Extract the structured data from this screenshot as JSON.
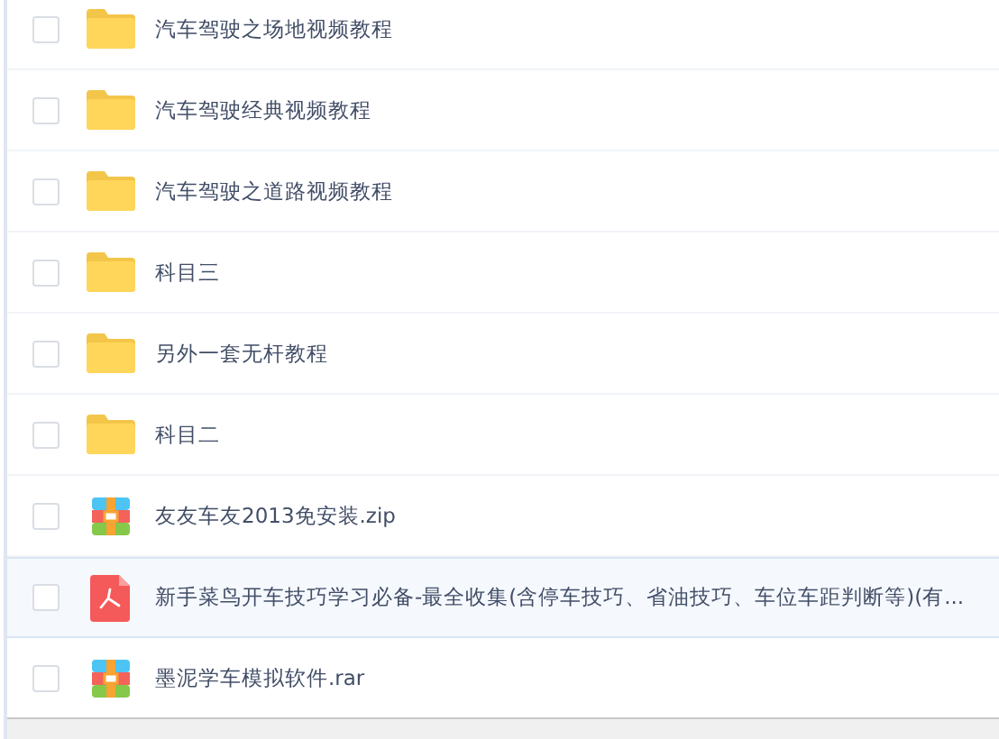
{
  "files": [
    {
      "name": "汽车驾驶之场地视频教程",
      "kind": "folder",
      "checked": false,
      "highlighted": false
    },
    {
      "name": "汽车驾驶经典视频教程",
      "kind": "folder",
      "checked": false,
      "highlighted": false
    },
    {
      "name": "汽车驾驶之道路视频教程",
      "kind": "folder",
      "checked": false,
      "highlighted": false
    },
    {
      "name": "科目三",
      "kind": "folder",
      "checked": false,
      "highlighted": false
    },
    {
      "name": "另外一套无杆教程",
      "kind": "folder",
      "checked": false,
      "highlighted": false
    },
    {
      "name": "科目二",
      "kind": "folder",
      "checked": false,
      "highlighted": false
    },
    {
      "name": "友友车友2013免安装.zip",
      "kind": "archive",
      "checked": false,
      "highlighted": false
    },
    {
      "name": "新手菜鸟开车技巧学习必备-最全收集(含停车技巧、省油技巧、车位车距判断等)(有...",
      "kind": "pdf",
      "checked": false,
      "highlighted": true
    },
    {
      "name": "墨泥学车模拟软件.rar",
      "kind": "archive",
      "checked": false,
      "highlighted": false
    }
  ]
}
